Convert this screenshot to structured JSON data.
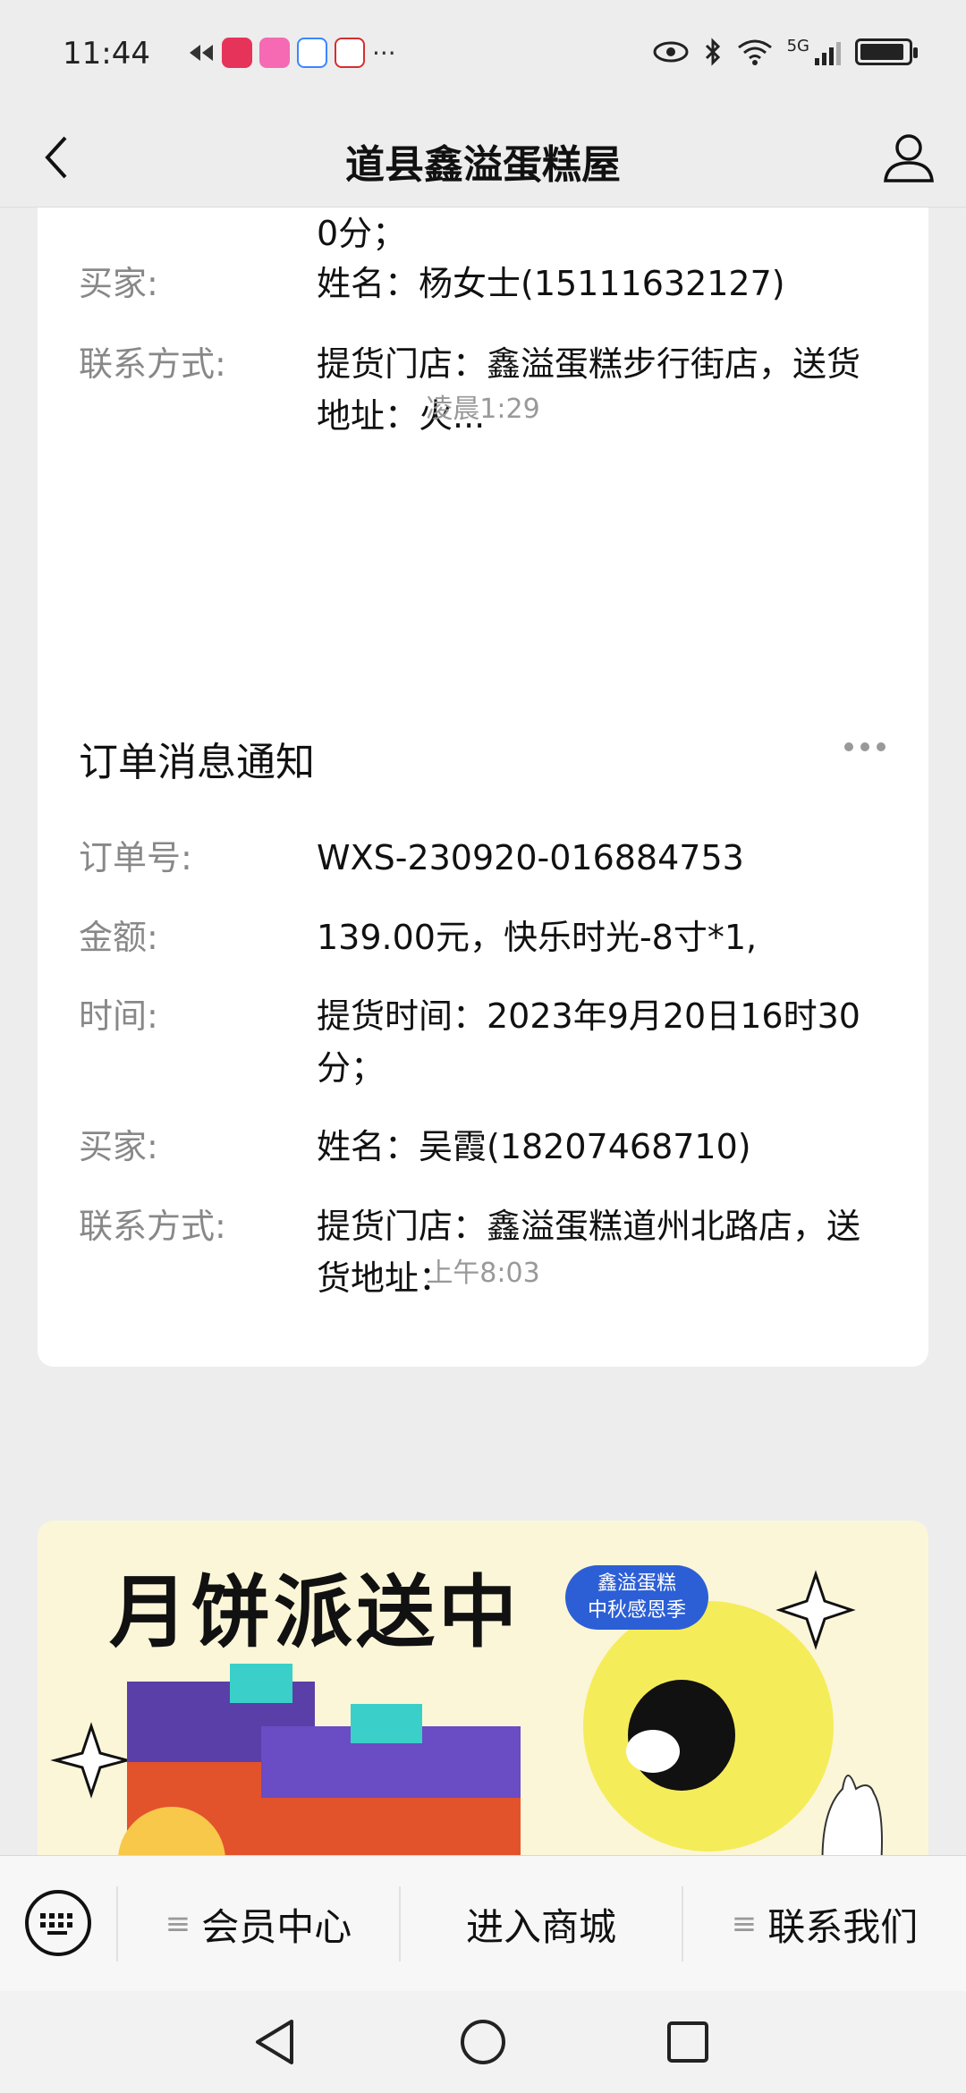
{
  "status_bar": {
    "time": "11:44",
    "network": "5G",
    "more": "···",
    "app_icons": [
      "app-icon-red",
      "app-icon-pink",
      "app-icon-chat",
      "sina-icon"
    ],
    "colors": {
      "app1": "#e6335a",
      "app2": "#f56ab3",
      "app3": "#3a86ff",
      "app4": "#d32f2f"
    }
  },
  "nav": {
    "title": "道县鑫溢蛋糕屋",
    "back_icon": "chevron-left-icon",
    "profile_icon": "user-icon"
  },
  "messages": [
    {
      "partial": true,
      "top_fragment": "0分；",
      "rows": [
        {
          "label": "买家:",
          "value": "姓名：杨女士(15111632127)"
        },
        {
          "label": "联系方式:",
          "value": "提货门店：鑫溢蛋糕步行街店，送货地址：火..."
        }
      ]
    },
    {
      "timestamp": "凌晨1:29",
      "title": "订单消息通知",
      "rows": [
        {
          "label": "订单号:",
          "value": "WXS-230920-016884753"
        },
        {
          "label": "金额:",
          "value": "139.00元，快乐时光-8寸*1,"
        },
        {
          "label": "时间:",
          "value": "提货时间：2023年9月20日16时30分；"
        },
        {
          "label": "买家:",
          "value": "姓名：吴霞(18207468710)"
        },
        {
          "label": "联系方式:",
          "value": "提货门店：鑫溢蛋糕道州北路店，送货地址："
        }
      ]
    },
    {
      "timestamp": "上午8:03",
      "banner": {
        "title": "月饼派送中",
        "badge_line1": "鑫溢蛋糕",
        "badge_line2": "中秋感恩季"
      }
    }
  ],
  "menu": {
    "keyboard_icon": "keyboard-icon",
    "items": [
      "会员中心",
      "进入商城",
      "联系我们"
    ]
  },
  "system_nav": [
    "back-triangle-icon",
    "home-circle-icon",
    "recents-square-icon"
  ]
}
